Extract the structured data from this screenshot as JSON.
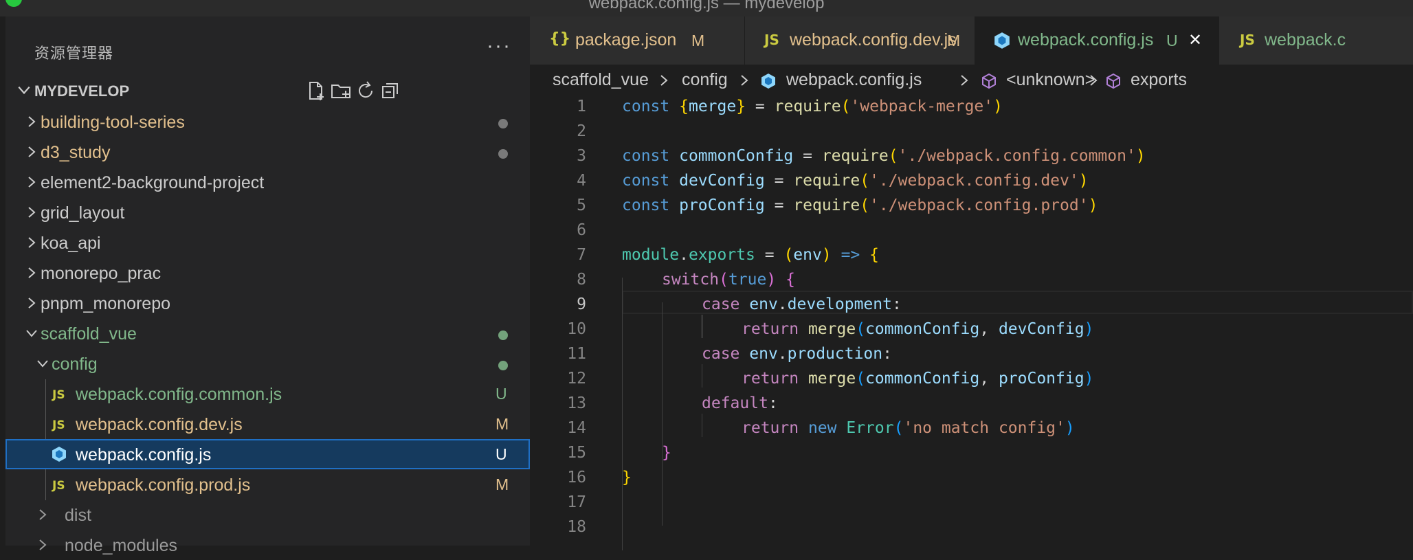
{
  "window": {
    "title": "webpack.config.js — mydevelop"
  },
  "sidebar": {
    "title": "资源管理器",
    "more": "···",
    "root": "MYDEVELOP",
    "tree": [
      {
        "label": "building-tool-series",
        "decor": "dot"
      },
      {
        "label": "d3_study",
        "decor": "dot"
      },
      {
        "label": "element2-background-project"
      },
      {
        "label": "grid_layout"
      },
      {
        "label": "koa_api"
      },
      {
        "label": "monorepo_prac"
      },
      {
        "label": "pnpm_monorepo"
      },
      {
        "label": "scaffold_vue",
        "decor": "dot"
      },
      {
        "label": "config",
        "decor": "dot"
      },
      {
        "label": "webpack.config.common.js",
        "icon": "JS",
        "badge": "U"
      },
      {
        "label": "webpack.config.dev.js",
        "icon": "JS",
        "badge": "M"
      },
      {
        "label": "webpack.config.js",
        "icon": "webpack-icon",
        "badge": "U"
      },
      {
        "label": "webpack.config.prod.js",
        "icon": "JS",
        "badge": "M"
      },
      {
        "label": "dist"
      },
      {
        "label": "node_modules"
      }
    ]
  },
  "tabs": [
    {
      "icon": "{}",
      "label": "package.json",
      "badge": "M"
    },
    {
      "icon": "JS",
      "label": "webpack.config.dev.js",
      "badge": "M"
    },
    {
      "icon": "webpack-icon",
      "label": "webpack.config.js",
      "badge": "U",
      "close": "✕"
    },
    {
      "icon": "JS",
      "label": "webpack.c"
    }
  ],
  "breadcrumb": [
    "scaffold_vue",
    "config",
    "webpack.config.js",
    "<unknown>",
    "exports"
  ],
  "editor": {
    "line_numbers": [
      "1",
      "2",
      "3",
      "4",
      "5",
      "6",
      "7",
      "8",
      "9",
      "10",
      "11",
      "12",
      "13",
      "14",
      "15",
      "16",
      "17",
      "18"
    ],
    "tokens": {
      "const": "const",
      "merge": "merge",
      "require": "require",
      "eq": " = ",
      "s_merge": "'webpack-merge'",
      "commonConfig": "commonConfig",
      "devConfig": "devConfig",
      "proConfig": "proConfig",
      "s_common": "'./webpack.config.common'",
      "s_dev": "'./webpack.config.dev'",
      "s_prod": "'./webpack.config.prod'",
      "module": "module",
      "exports": "exports",
      "env": "env",
      "arrow": "=>",
      "switch": "switch",
      "true": "true",
      "case": "case",
      "development": "development",
      "production": "production",
      "return": "return",
      "default": "default",
      "new": "new",
      "Error": "Error",
      "s_err": "'no match config'"
    }
  }
}
